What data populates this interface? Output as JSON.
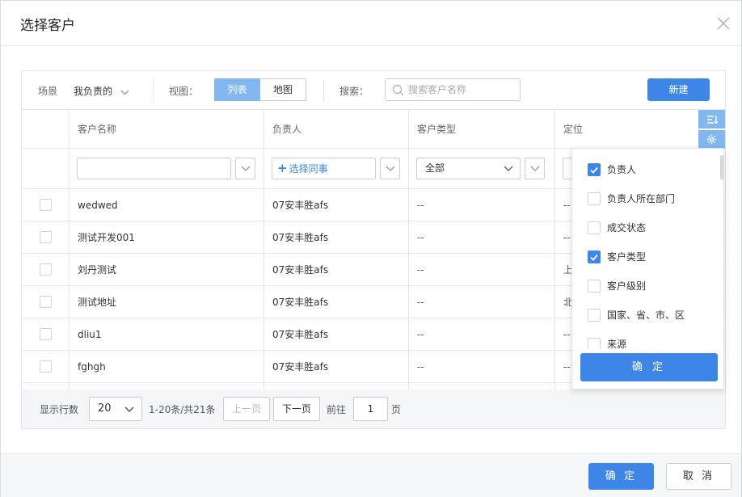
{
  "dialog": {
    "title": "选择客户"
  },
  "toolbar": {
    "scene_label": "场景",
    "scene_value": "我负责的",
    "view_label": "视图：",
    "view_list": "列表",
    "view_map": "地图",
    "search_label": "搜索：",
    "search_placeholder": "搜索客户名称",
    "new_button": "新建"
  },
  "table": {
    "columns": [
      "客户名称",
      "负责人",
      "客户类型",
      "定位"
    ],
    "filters": {
      "owner_pick": "选择同事",
      "type_value": "全部"
    },
    "rows": [
      {
        "name": "wedwed",
        "owner": "07安丰胜afs",
        "type": "--",
        "location": "--"
      },
      {
        "name": "测试开发001",
        "owner": "07安丰胜afs",
        "type": "--",
        "location": "--"
      },
      {
        "name": "刘丹测试",
        "owner": "07安丰胜afs",
        "type": "--",
        "location": "上"
      },
      {
        "name": "测试地址",
        "owner": "07安丰胜afs",
        "type": "--",
        "location": "北"
      },
      {
        "name": "dliu1",
        "owner": "07安丰胜afs",
        "type": "--",
        "location": "--"
      },
      {
        "name": "fghgh",
        "owner": "07安丰胜afs",
        "type": "--",
        "location": "--"
      }
    ]
  },
  "pager": {
    "rows_label": "显示行数",
    "page_size": "20",
    "summary": "1-20条/共21条",
    "prev": "上一页",
    "next": "下一页",
    "goto_label": "前往",
    "page": "1",
    "page_unit": "页"
  },
  "column_popup": {
    "items": [
      {
        "label": "负责人",
        "checked": true
      },
      {
        "label": "负责人所在部门",
        "checked": false
      },
      {
        "label": "成交状态",
        "checked": false
      },
      {
        "label": "客户类型",
        "checked": true
      },
      {
        "label": "客户级别",
        "checked": false
      },
      {
        "label": "国家、省、市、区",
        "checked": false
      },
      {
        "label": "来源",
        "checked": false
      }
    ],
    "confirm": "确 定"
  },
  "footer": {
    "confirm": "确 定",
    "cancel": "取 消"
  },
  "colors": {
    "primary": "#3d86e8",
    "light_primary": "#83b7ef",
    "border": "#e3e6ea"
  }
}
